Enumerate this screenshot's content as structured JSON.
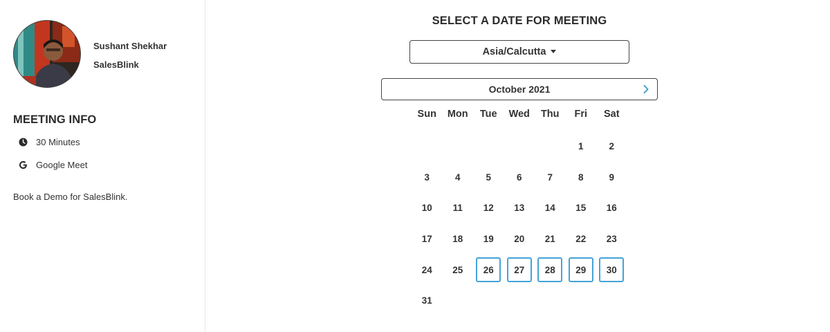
{
  "host": {
    "name": "Sushant Shekhar",
    "company": "SalesBlink"
  },
  "meeting_info": {
    "heading": "MEETING INFO",
    "duration": {
      "icon": "clock-icon",
      "label": "30 Minutes"
    },
    "location": {
      "icon": "google-icon",
      "label": "Google Meet"
    },
    "description": "Book a Demo for SalesBlink."
  },
  "scheduler": {
    "title": "SELECT A DATE FOR MEETING",
    "timezone": "Asia/Calcutta",
    "month_label": "October 2021",
    "next_icon": "chevron-right-icon",
    "weekdays": [
      "Sun",
      "Mon",
      "Tue",
      "Wed",
      "Thu",
      "Fri",
      "Sat"
    ],
    "leading_blanks": 5,
    "days": [
      "1",
      "2",
      "3",
      "4",
      "5",
      "6",
      "7",
      "8",
      "9",
      "10",
      "11",
      "12",
      "13",
      "14",
      "15",
      "16",
      "17",
      "18",
      "19",
      "20",
      "21",
      "22",
      "23",
      "24",
      "25",
      "26",
      "27",
      "28",
      "29",
      "30",
      "31"
    ],
    "available_days": [
      "26",
      "27",
      "28",
      "29",
      "30"
    ]
  },
  "colors": {
    "accent": "#45a3d8",
    "text": "#333333",
    "divider": "#e4e4e4"
  }
}
